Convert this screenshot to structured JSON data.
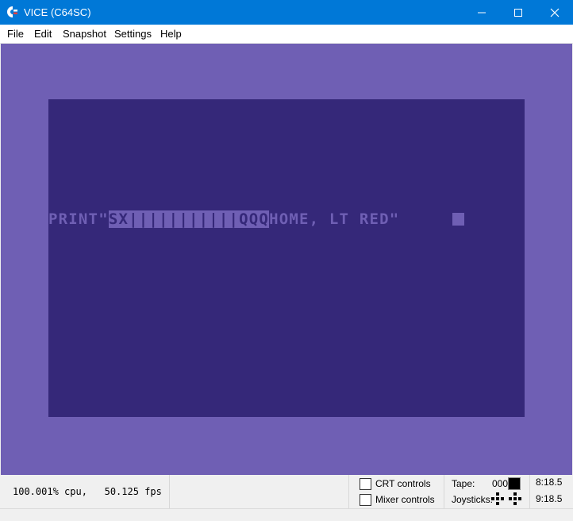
{
  "window": {
    "title": "VICE (C64SC)",
    "icon": "commodore-logo-icon",
    "controls": [
      "minimize-icon",
      "maximize-icon",
      "close-icon"
    ]
  },
  "menu": {
    "items": [
      "File",
      "Edit",
      "Snapshot",
      "Settings",
      "Help"
    ]
  },
  "screen": {
    "border_color": "#6f5fb4",
    "background_color": "#352879",
    "text_color": "#6f5fb4",
    "line_prefix": "PRINT\"",
    "line_reversed": "SX|||||||||||QQQ",
    "line_suffix": "HOME, LT RED\""
  },
  "status": {
    "cpu": "100.001% cpu,",
    "fps": "50.125 fps",
    "crt_controls_label": "CRT controls",
    "crt_controls_checked": false,
    "mixer_controls_label": "Mixer controls",
    "mixer_controls_checked": false,
    "tape_label": "Tape:",
    "tape_counter": "000",
    "joysticks_label": "Joysticks:",
    "drive8": "8:18.5",
    "drive9": "9:18.5"
  }
}
